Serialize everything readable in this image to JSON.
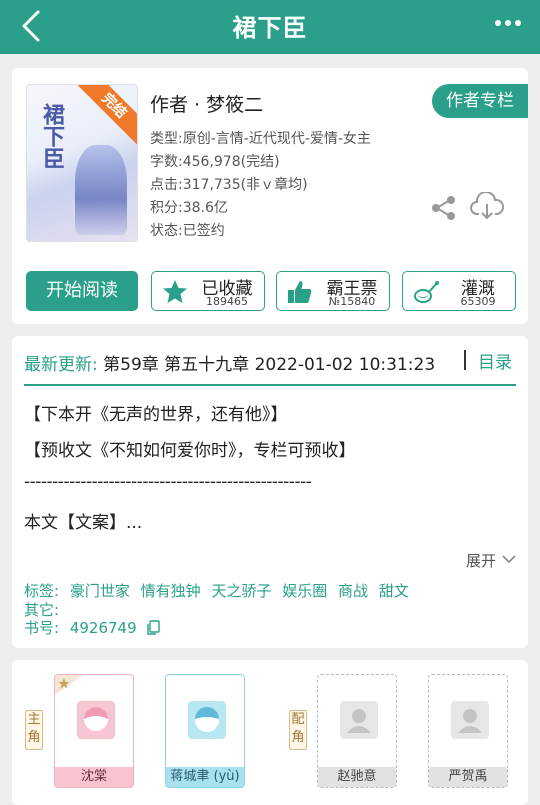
{
  "header": {
    "title": "裙下臣"
  },
  "book": {
    "cover_calligraphy": "裙下臣",
    "cover_ribbon": "完结",
    "author_line": "作者 · 梦筱二",
    "author_column_label": "作者专栏",
    "meta": [
      "类型:原创-言情-近代现代-爱情-女主",
      "字数:456,978(完结)",
      "点击:317,735(非ｖ章均)",
      "积分:38.6亿",
      "状态:已签约"
    ]
  },
  "actions": {
    "read_label": "开始阅读",
    "favorite": {
      "label": "已收藏",
      "count": "189465"
    },
    "vote": {
      "label": "霸王票",
      "count": "№15840"
    },
    "irrigate": {
      "label": "灌溉",
      "count": "65309"
    }
  },
  "latest": {
    "label": "最新更新:",
    "text": "第59章 第五十九章 2022-01-02 10:31:23",
    "catalog_label": "目录"
  },
  "description": {
    "lines": [
      "【下本开《无声的世界，还有他》】",
      "【预收文《不知如何爱你时》，专栏可预收】",
      "---------------------------------------------------",
      "本文【文案】..."
    ],
    "expand_label": "展开"
  },
  "tags": {
    "label": "标签:",
    "items": [
      "豪门世家",
      "情有独钟",
      "天之骄子",
      "娱乐圈",
      "商战",
      "甜文"
    ],
    "other_label": "其它:",
    "book_id_label": "书号:",
    "book_id": "4926749"
  },
  "roles": {
    "main_label": "主角",
    "support_label": "配角",
    "characters": [
      {
        "name": "沈棠"
      },
      {
        "name": "蒋城聿 (yù)"
      },
      {
        "name": "赵驰意"
      },
      {
        "name": "严贺禹"
      }
    ]
  },
  "colors": {
    "accent": "#2aa08a",
    "ribbon": "#f07a2a"
  }
}
